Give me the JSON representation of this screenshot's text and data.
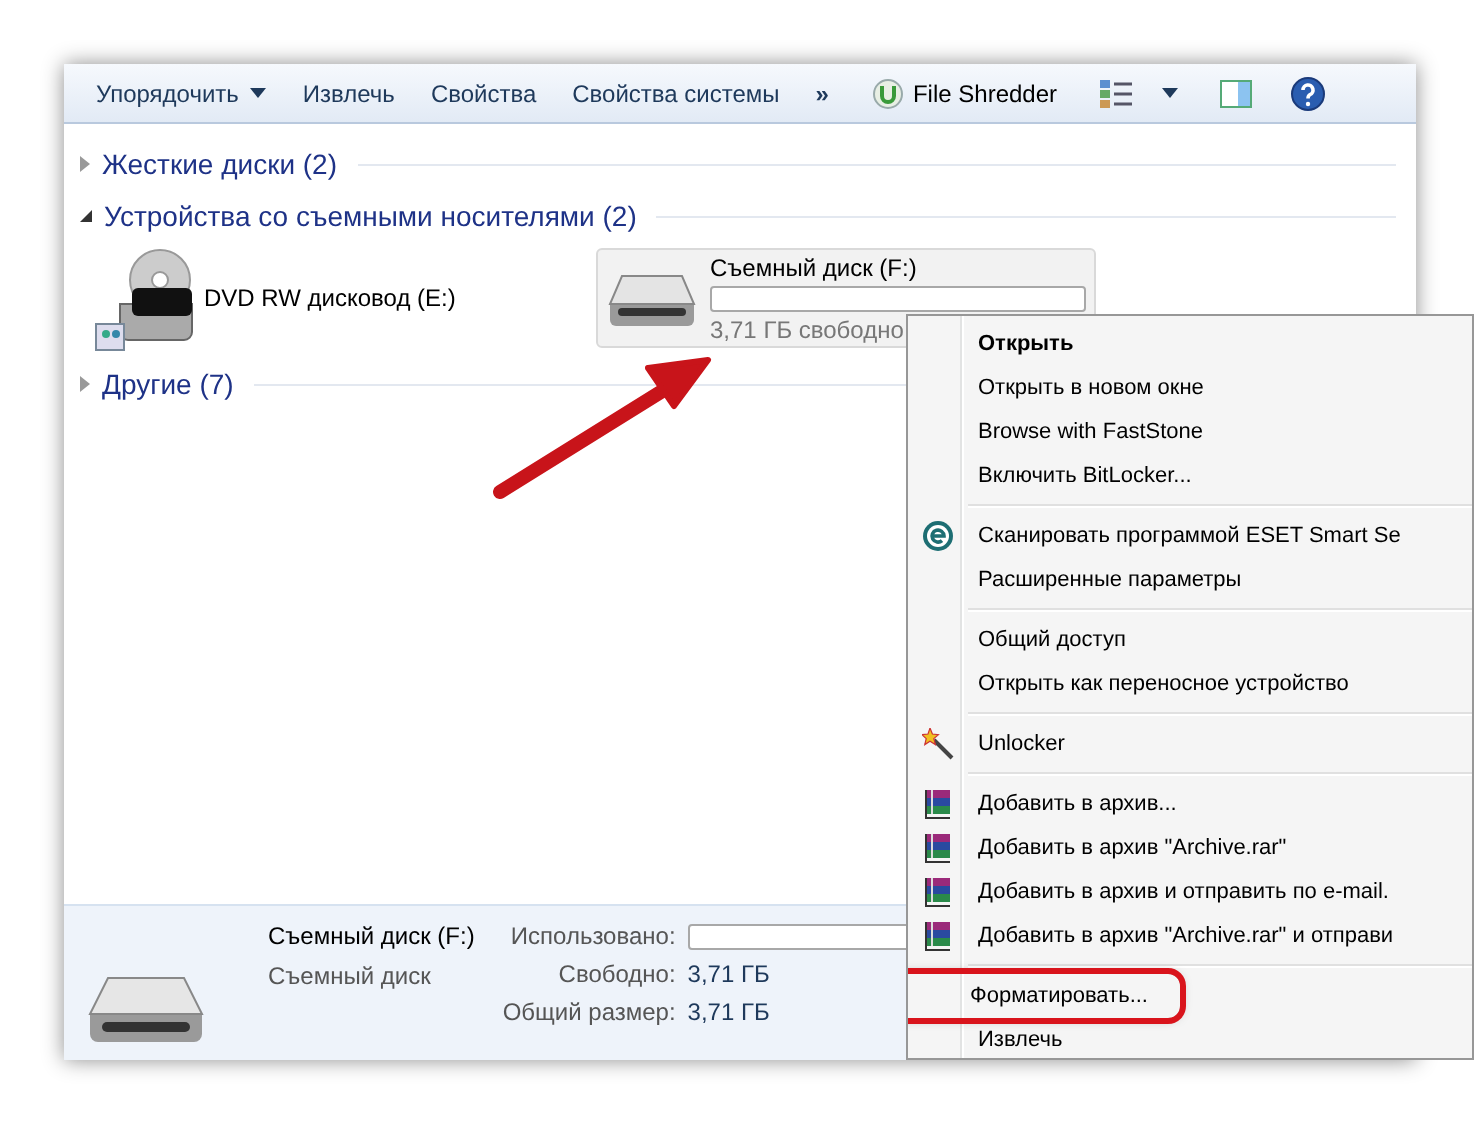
{
  "toolbar": {
    "items": [
      {
        "label": "Упорядочить",
        "dropdown": true
      },
      {
        "label": "Извлечь",
        "dropdown": false
      },
      {
        "label": "Свойства",
        "dropdown": false
      },
      {
        "label": "Свойства системы",
        "dropdown": false
      }
    ],
    "more": "»",
    "shredder": "File Shredder"
  },
  "groups": [
    {
      "title": "Жесткие диски (2)",
      "expanded": false
    },
    {
      "title": "Устройства со съемными носителями (2)",
      "expanded": true,
      "devices": [
        {
          "kind": "dvd",
          "name": "DVD RW дисковод (E:)",
          "selected": false
        },
        {
          "kind": "removable",
          "name": "Съемный диск (F:)",
          "free": "3,71 ГБ свободно",
          "selected": true
        }
      ]
    },
    {
      "title": "Другие (7)",
      "expanded": false
    }
  ],
  "details": {
    "name": "Съемный диск (F:)",
    "type": "Съемный диск",
    "used_label": "Использовано:",
    "rows": [
      {
        "label": "Свободно:",
        "value": "3,71 ГБ"
      },
      {
        "label": "Общий размер:",
        "value": "3,71 ГБ"
      }
    ]
  },
  "context_menu": {
    "groups": [
      [
        {
          "label": "Открыть",
          "default": true,
          "kind": "plain",
          "highlighted": false
        },
        {
          "label": "Открыть в новом окне",
          "default": false,
          "kind": "plain",
          "highlighted": false
        },
        {
          "label": "Browse with FastStone",
          "default": false,
          "kind": "plain",
          "highlighted": false
        },
        {
          "label": "Включить BitLocker...",
          "default": false,
          "kind": "plain",
          "highlighted": false
        }
      ],
      [
        {
          "label": "Сканировать программой ESET Smart Se",
          "default": false,
          "kind": "antivirus",
          "highlighted": false
        },
        {
          "label": "Расширенные параметры",
          "default": false,
          "kind": "plain",
          "highlighted": false
        }
      ],
      [
        {
          "label": "Общий доступ",
          "default": false,
          "kind": "plain",
          "highlighted": false
        },
        {
          "label": "Открыть как переносное устройство",
          "default": false,
          "kind": "plain",
          "highlighted": false
        }
      ],
      [
        {
          "label": "Unlocker",
          "default": false,
          "kind": "unlocker",
          "highlighted": false
        }
      ],
      [
        {
          "label": "Добавить в архив...",
          "default": false,
          "kind": "archive",
          "highlighted": false
        },
        {
          "label": "Добавить в архив \"Archive.rar\"",
          "default": false,
          "kind": "archive",
          "highlighted": false
        },
        {
          "label": "Добавить в архив и отправить по e-mail.",
          "default": false,
          "kind": "archive",
          "highlighted": false
        },
        {
          "label": "Добавить в архив \"Archive.rar\" и отправи",
          "default": false,
          "kind": "archive",
          "highlighted": false
        }
      ],
      [
        {
          "label": "Форматировать...",
          "default": false,
          "kind": "plain",
          "highlighted": true
        },
        {
          "label": "Извлечь",
          "default": false,
          "kind": "plain",
          "highlighted": false
        }
      ]
    ]
  }
}
